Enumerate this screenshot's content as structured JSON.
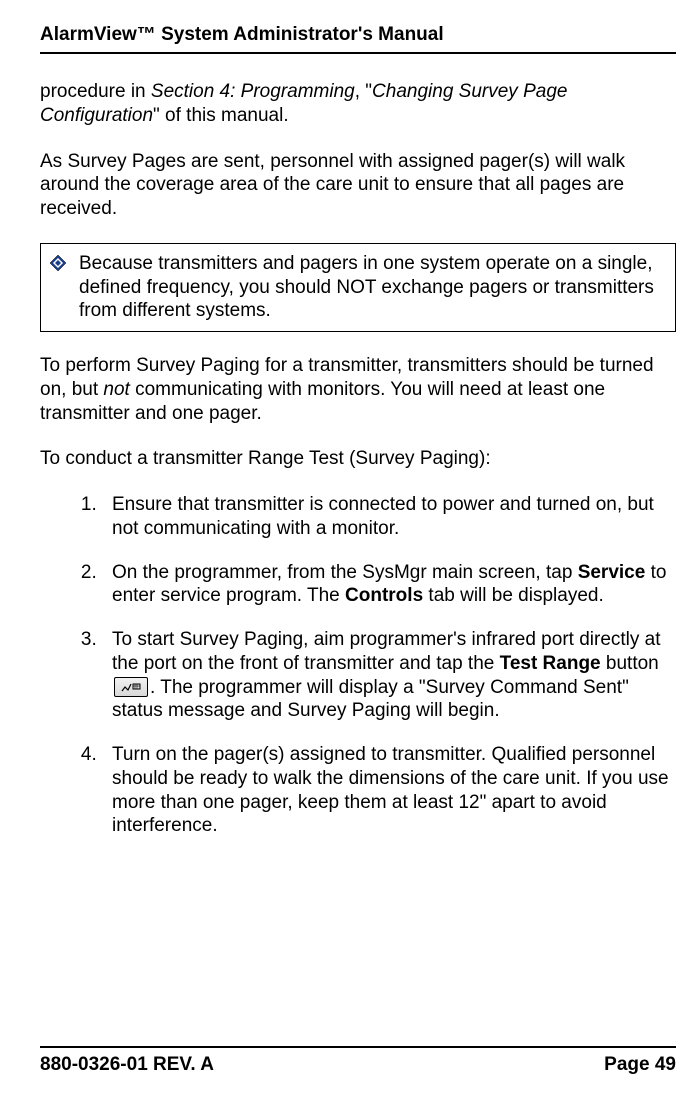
{
  "header": {
    "title": "AlarmView™ System Administrator's Manual"
  },
  "para1": {
    "lead": "procedure in ",
    "italic1": "Section 4: Programming",
    "mid": ", \"",
    "italic2": "Changing Survey Page Configuration",
    "tail": "\" of this manual."
  },
  "para2": "As Survey Pages are sent, personnel with assigned pager(s) will walk around the coverage area of the care unit to ensure that all pages are received.",
  "callout": {
    "text": "Because transmitters and pagers in one system operate on a single, defined frequency, you should NOT exchange pagers or transmitters from different systems."
  },
  "para3": {
    "a": "To perform Survey Paging for a transmitter, transmitters should be turned on, but ",
    "not": "not",
    "b": " communicating with monitors. You will need at least one transmitter and one pager."
  },
  "para4": "To conduct a transmitter Range Test (Survey Paging):",
  "steps": {
    "s1": "Ensure that transmitter is connected to power and turned on, but not communicating with a monitor.",
    "s2": {
      "a": "On the programmer, from the SysMgr main screen, tap ",
      "service": "Service",
      "b": " to enter service program. The ",
      "controls": "Controls",
      "c": " tab will be displayed."
    },
    "s3": {
      "a": "To start Survey Paging, aim programmer's infrared port directly at the port on the front of transmitter and tap the ",
      "testrange": "Test Range",
      "b": " button ",
      "c": ". The programmer will display a \"Survey Command Sent\" status message and Survey Paging will begin."
    },
    "s4": "Turn on the pager(s) assigned to transmitter. Qualified personnel should be ready to walk the dimensions of the care unit. If you use more than one pager, keep them at least 12\" apart to avoid interference."
  },
  "footer": {
    "rev": "880-0326-01 REV. A",
    "page": "Page 49"
  }
}
